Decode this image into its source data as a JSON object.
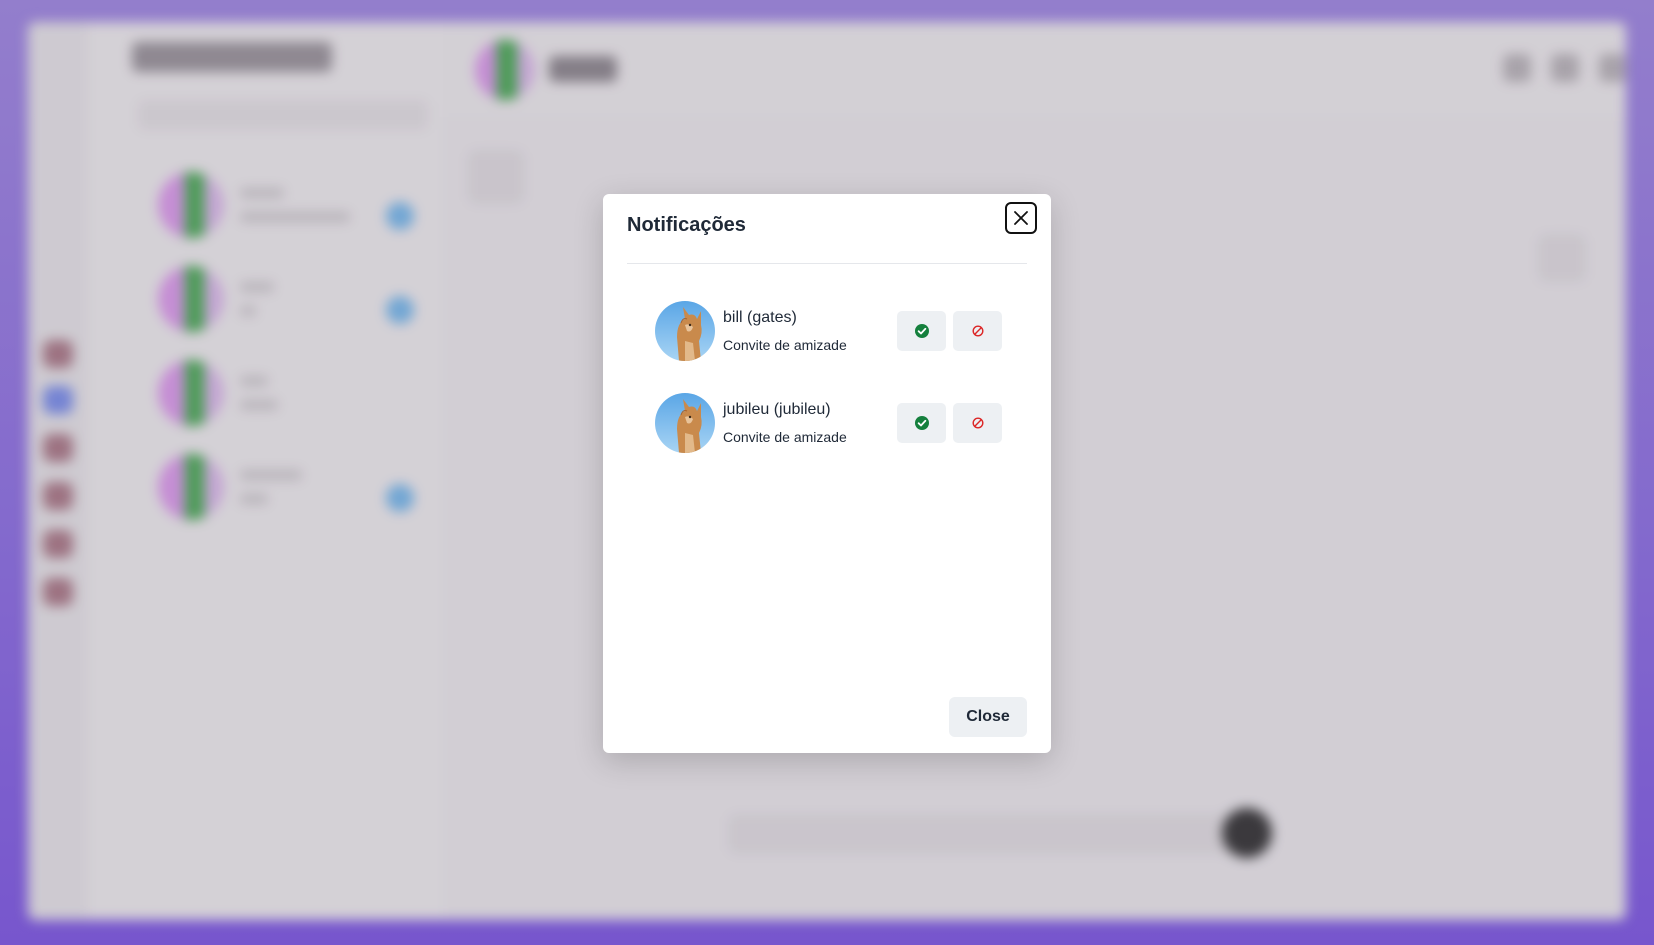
{
  "modal": {
    "title": "Notificações",
    "close_button_label": "Close",
    "close_icon": "close-icon"
  },
  "notifications": [
    {
      "name": "bill (gates)",
      "type": "Convite de amizade",
      "avatar": "cat-avatar",
      "accept_icon": "check-circle-icon",
      "reject_icon": "block-icon"
    },
    {
      "name": "jubileu (jubileu)",
      "type": "Convite de amizade",
      "avatar": "cat-avatar",
      "accept_icon": "check-circle-icon",
      "reject_icon": "block-icon"
    }
  ],
  "colors": {
    "accept": "#15803d",
    "reject": "#dc2626",
    "page_gradient_top": "#8f78cf",
    "page_gradient_bottom": "#6f4bd0",
    "modal_bg": "#ffffff",
    "button_bg": "#edf0f3"
  }
}
